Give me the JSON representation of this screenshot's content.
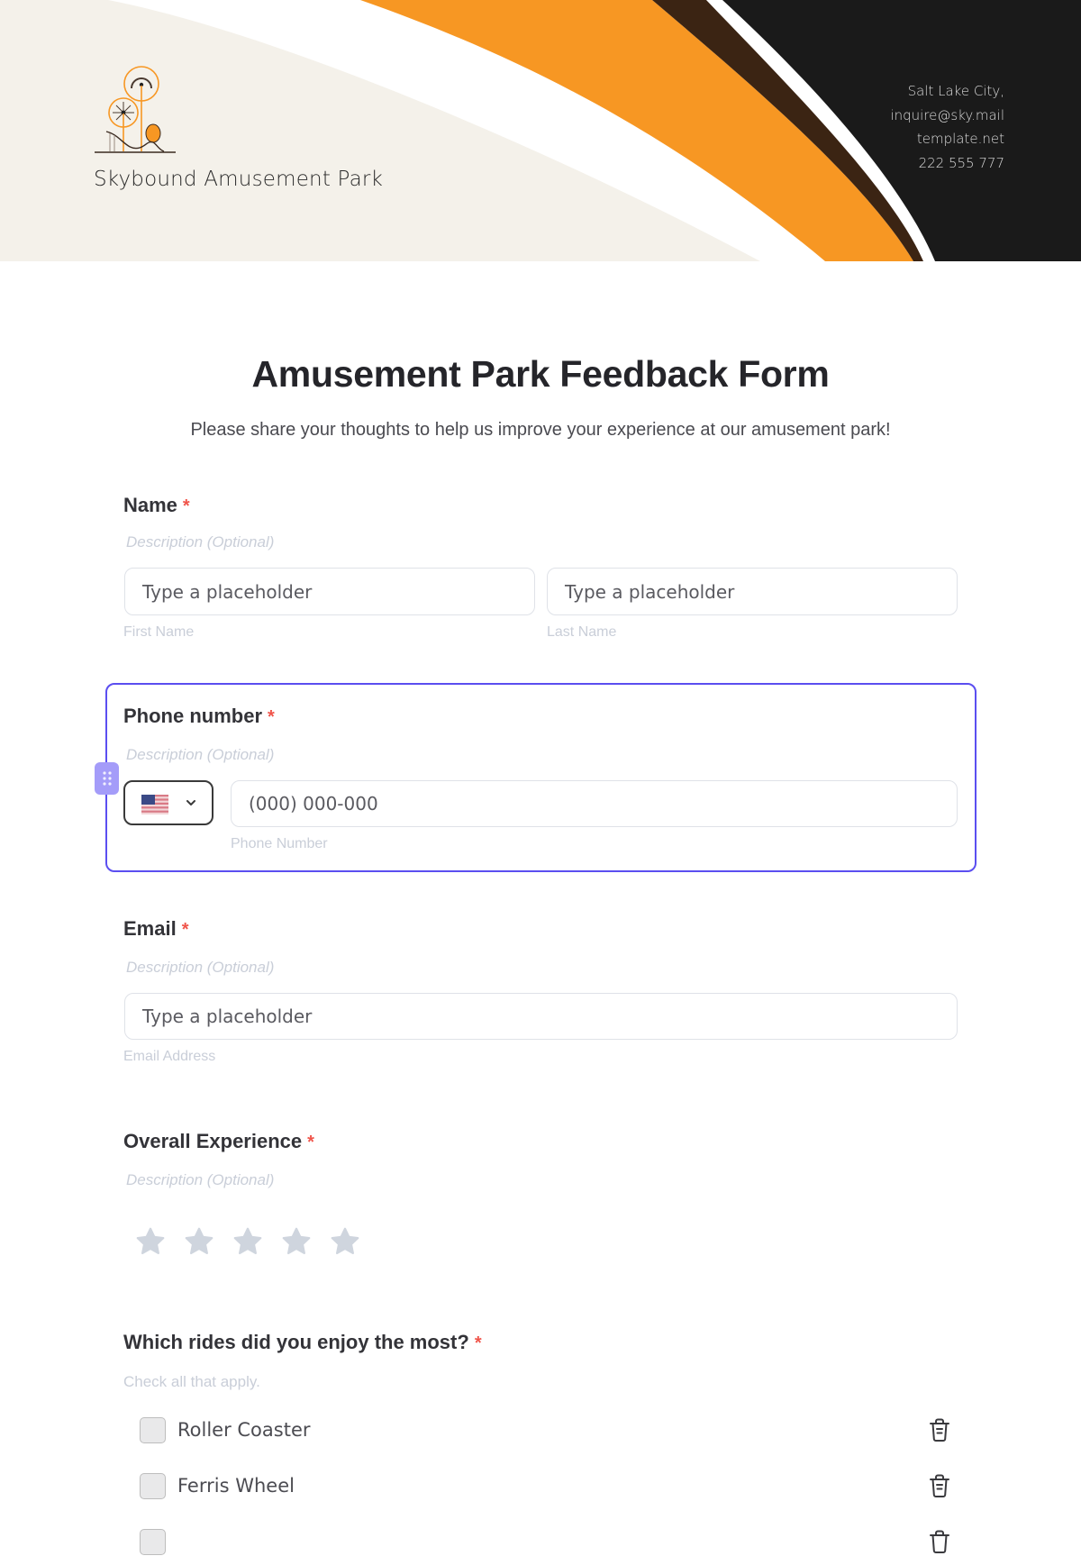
{
  "header": {
    "brand_name": "Skybound Amusement Park",
    "contact": [
      "Salt Lake City,",
      "inquire@sky.mail",
      "template.net",
      "222 555 777"
    ],
    "colors": {
      "beige": "#f4f1ea",
      "orange": "#f79723",
      "brown": "#3b2413",
      "dark": "#1a1a1a"
    }
  },
  "form": {
    "title": "Amusement Park Feedback Form",
    "subtitle": "Please share your thoughts to help us improve your experience at our amusement park!",
    "required_mark": "*",
    "name": {
      "label": "Name",
      "description": "Description (Optional)",
      "first": {
        "placeholder": "Type a placeholder",
        "helper": "First Name"
      },
      "last": {
        "placeholder": "Type a placeholder",
        "helper": "Last Name"
      }
    },
    "phone": {
      "label": "Phone number",
      "description": "Description (Optional)",
      "country": "US",
      "placeholder": "(000) 000-000",
      "helper": "Phone Number",
      "focus_color": "#5b4ef0"
    },
    "email": {
      "label": "Email",
      "description": "Description (Optional)",
      "placeholder": "Type a placeholder",
      "helper": "Email Address"
    },
    "experience": {
      "label": "Overall Experience",
      "description": "Description (Optional)",
      "rating": 0,
      "max_rating": 5
    },
    "rides": {
      "label": "Which rides did you enjoy the most?",
      "hint": "Check all that apply.",
      "options": [
        {
          "label": "Roller Coaster",
          "checked": false
        },
        {
          "label": "Ferris Wheel",
          "checked": false
        },
        {
          "label": "",
          "checked": false
        }
      ]
    }
  }
}
